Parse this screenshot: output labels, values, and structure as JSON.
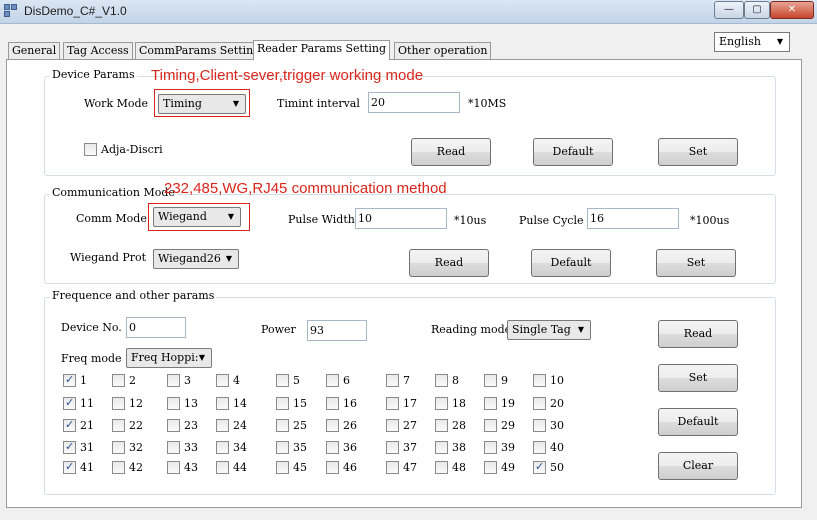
{
  "window": {
    "title": "DisDemo_C#_V1.0",
    "controls": {
      "minimize": "—",
      "maximize": "▢",
      "close": "✕"
    }
  },
  "language": {
    "selected": "English"
  },
  "tabs": [
    "General",
    "Tag Access",
    "CommParams Setting",
    "Reader Params Setting",
    "Other operation"
  ],
  "device_params": {
    "title": "Device Params",
    "annotation": "Timing,Client-sever,trigger working mode",
    "work_mode_label": "Work Mode",
    "work_mode_value": "Timing",
    "timing_interval_label": "Timint interval",
    "timing_interval_value": "20",
    "timing_interval_unit": "*10MS",
    "adja_discri_label": "Adja-Discri",
    "adja_discri_checked": false,
    "buttons": {
      "read": "Read",
      "default": "Default",
      "set": "Set"
    }
  },
  "communication_mode": {
    "title": "Communication Mode",
    "annotation": "232,485,WG,RJ45 communication method",
    "comm_mode_label": "Comm Mode",
    "comm_mode_value": "Wiegand",
    "pulse_width_label": "Pulse Width",
    "pulse_width_value": "10",
    "pulse_width_unit": "*10us",
    "pulse_cycle_label": "Pulse Cycle",
    "pulse_cycle_value": "16",
    "pulse_cycle_unit": "*100us",
    "wiegand_prot_label": "Wiegand Prot",
    "wiegand_prot_value": "Wiegand26",
    "buttons": {
      "read": "Read",
      "default": "Default",
      "set": "Set"
    }
  },
  "freq_params": {
    "title": "Frequence and other params",
    "device_no_label": "Device No.",
    "device_no_value": "0",
    "power_label": "Power",
    "power_value": "93",
    "reading_mode_label": "Reading mode",
    "reading_mode_value": "Single Tag",
    "freq_mode_label": "Freq mode",
    "freq_mode_value": "Freq Hoppi:",
    "checked_channels": [
      1,
      11,
      21,
      31,
      41,
      50
    ],
    "buttons": {
      "read": "Read",
      "set": "Set",
      "default": "Default",
      "clear": "Clear"
    }
  },
  "icons": {
    "check": "✓",
    "dropdown": "▼"
  }
}
